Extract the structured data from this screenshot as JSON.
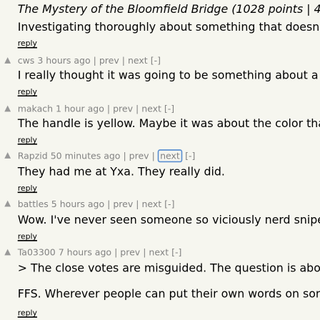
{
  "story": {
    "title": "The Mystery of the Bloomfield Bridge",
    "points_line": "(1028 points | 4 months ago"
  },
  "comments": [
    {
      "user": "",
      "age": "",
      "text": "Investigating thoroughly about something that doesn't fucking mat",
      "reply": "reply"
    },
    {
      "user": "cws",
      "age": "3 hours ago",
      "prev": "prev",
      "next": "next",
      "collapse": "[-]",
      "text": "I really thought it was going to be something about a \"Y axis\" or \"Y",
      "reply": "reply"
    },
    {
      "user": "makach",
      "age": "1 hour ago",
      "prev": "prev",
      "next": "next",
      "collapse": "[-]",
      "text": "The handle is yellow. Maybe it was about the color than the object?",
      "reply": "reply"
    },
    {
      "user": "Rapzid",
      "age": "50 minutes ago",
      "prev": "prev",
      "next": "next",
      "collapse": "[-]",
      "text": "They had me at Yxa. They really did.",
      "reply": "reply"
    },
    {
      "user": "battles",
      "age": "5 hours ago",
      "prev": "prev",
      "next": "next",
      "collapse": "[-]",
      "text": "Wow. I've never seen someone so viciously nerd sniped in my life.",
      "reply": "reply"
    },
    {
      "user": "Ta03300",
      "age": "7 hours ago",
      "prev": "prev",
      "next": "next",
      "collapse": "[-]",
      "text": "> The close votes are misguided. The question is about English. Th",
      "text2": "FFS. Wherever people can put their own words on someone else's",
      "reply": "reply"
    }
  ],
  "separator": "|",
  "vote_icon": "upvote-arrow-icon"
}
